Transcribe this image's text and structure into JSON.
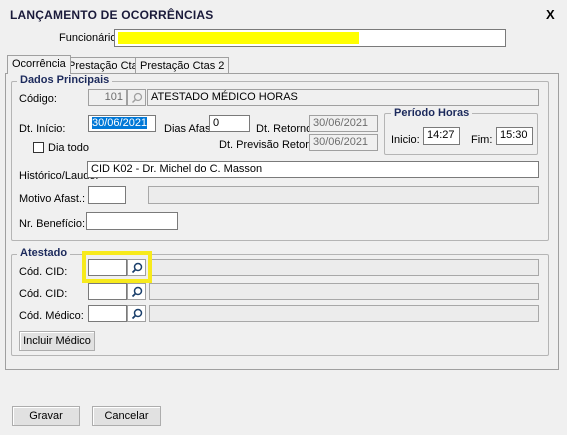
{
  "window": {
    "title": "LANÇAMENTO DE OCORRÊNCIAS",
    "close_label": "X"
  },
  "header": {
    "funcionario_label": "Funcionário:"
  },
  "tabs": [
    {
      "label": "Ocorrência"
    },
    {
      "label": "Prestação Ctas"
    },
    {
      "label": "Prestação Ctas 2"
    }
  ],
  "dados_principais": {
    "legend": "Dados Principais",
    "codigo_label": "Código:",
    "codigo_value": "101",
    "codigo_desc": "ATESTADO MÉDICO HORAS",
    "dt_inicio_label": "Dt. Início:",
    "dt_inicio_value": "30/06/2021",
    "dias_afast_label": "Dias Afast.",
    "dias_afast_value": "0",
    "dt_retorno_label": "Dt. Retorno:",
    "dt_retorno_value": "30/06/2021",
    "dia_todo_label": "Dia todo",
    "dt_prev_retorno_label": "Dt. Previsão Retorno:",
    "dt_prev_retorno_value": "30/06/2021",
    "historico_label": "Histórico/Laudo:",
    "historico_value": "CID K02 - Dr. Michel do C. Masson",
    "motivo_label": "Motivo Afast.:",
    "motivo_value": "",
    "beneficio_label": "Nr. Benefício:",
    "beneficio_value": ""
  },
  "periodo_horas": {
    "legend": "Período Horas",
    "inicio_label": "Inicio:",
    "inicio_value": "14:27",
    "fim_label": "Fim:",
    "fim_value": "15:30"
  },
  "atestado": {
    "legend": "Atestado",
    "cid1_label": "Cód. CID:",
    "cid2_label": "Cód. CID:",
    "medico_label": "Cód. Médico:",
    "incluir_medico_label": "Incluir Médico"
  },
  "footer": {
    "gravar_label": "Gravar",
    "cancelar_label": "Cancelar"
  },
  "colors": {
    "highlight": "#f7ea1c",
    "selection": "#0078d7"
  }
}
